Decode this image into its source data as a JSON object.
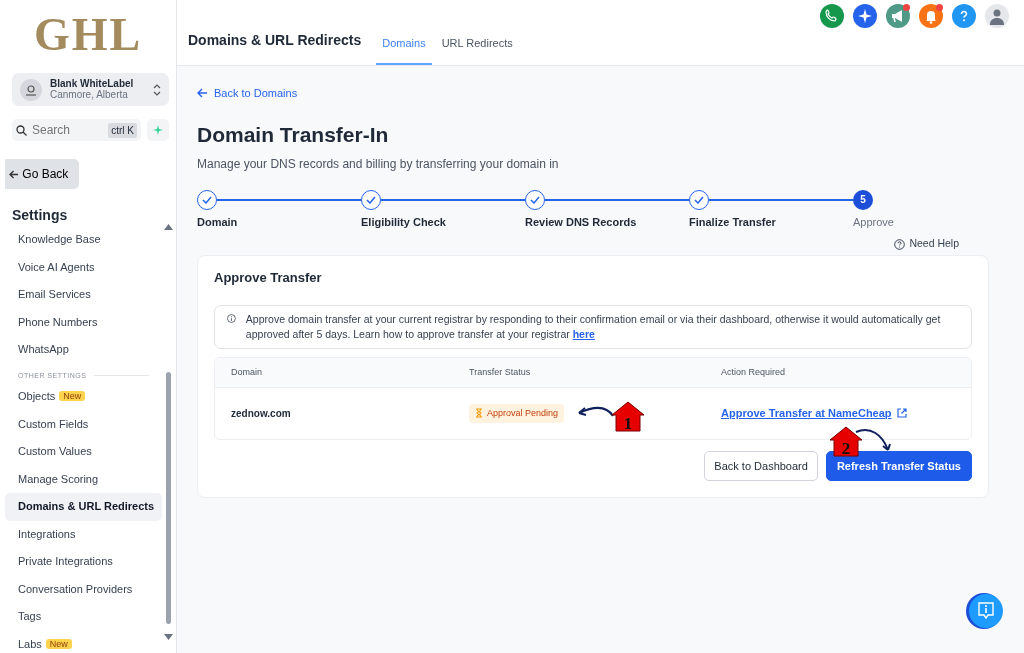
{
  "sidebar": {
    "logo": "GHL",
    "account": {
      "name": "Blank WhiteLabel",
      "location": "Canmore, Alberta"
    },
    "search": {
      "placeholder": "Search",
      "shortcut": "ctrl K"
    },
    "go_back": "Go Back",
    "heading": "Settings",
    "items": [
      {
        "kind": "item",
        "label": "Knowledge Base",
        "selected": false
      },
      {
        "kind": "item",
        "label": "Voice AI Agents",
        "selected": false
      },
      {
        "kind": "item",
        "label": "Email Services",
        "selected": false
      },
      {
        "kind": "item",
        "label": "Phone Numbers",
        "selected": false
      },
      {
        "kind": "item",
        "label": "WhatsApp",
        "selected": false
      },
      {
        "kind": "section",
        "label": "OTHER SETTINGS"
      },
      {
        "kind": "item",
        "label": "Objects",
        "badge": "New",
        "selected": false
      },
      {
        "kind": "item",
        "label": "Custom Fields",
        "selected": false
      },
      {
        "kind": "item",
        "label": "Custom Values",
        "selected": false
      },
      {
        "kind": "item",
        "label": "Manage Scoring",
        "selected": false
      },
      {
        "kind": "item",
        "label": "Domains & URL Redirects",
        "selected": true
      },
      {
        "kind": "item",
        "label": "Integrations",
        "selected": false
      },
      {
        "kind": "item",
        "label": "Private Integrations",
        "selected": false
      },
      {
        "kind": "item",
        "label": "Conversation Providers",
        "selected": false
      },
      {
        "kind": "item",
        "label": "Tags",
        "selected": false
      },
      {
        "kind": "item",
        "label": "Labs",
        "badge": "New",
        "selected": false
      }
    ]
  },
  "header": {
    "title": "Domains & URL Redirects",
    "tabs": [
      {
        "label": "Domains",
        "selected": true
      },
      {
        "label": "URL Redirects",
        "selected": false
      }
    ],
    "icons": [
      {
        "kind": "phone",
        "color": "#16984c",
        "dot": false
      },
      {
        "kind": "sparkle",
        "color": "#2563eb",
        "dot": false
      },
      {
        "kind": "megaphone",
        "color": "#4e9a86",
        "dot": true
      },
      {
        "kind": "bell",
        "color": "#f97316",
        "dot": true
      },
      {
        "kind": "help",
        "color": "#2196f3",
        "dot": false
      },
      {
        "kind": "avatar",
        "color": "#e5e7eb",
        "dot": false
      }
    ]
  },
  "back_link": "Back to Domains",
  "title": "Domain Transfer-In",
  "subtitle": "Manage your DNS records and billing by transferring your domain in",
  "steps": [
    {
      "label": "Domain",
      "done": true
    },
    {
      "label": "Eligibility Check",
      "done": true
    },
    {
      "label": "Review DNS Records",
      "done": true
    },
    {
      "label": "Finalize Transfer",
      "done": true
    },
    {
      "label": "Approve",
      "done": false,
      "number": "5"
    }
  ],
  "need_help": "Need Help",
  "card": {
    "title": "Approve Transfer",
    "info": "Approve domain transfer at your current registrar by responding to their confirmation email or via their dashboard, otherwise it would automatically get approved after 5 days. Learn how to approve transfer at your registrar",
    "info_link": "here",
    "table": {
      "columns": [
        "Domain",
        "Transfer Status",
        "Action Required"
      ],
      "rows": [
        {
          "domain": "zednow.com",
          "status": "Approval Pending",
          "action": "Approve Transfer at NameCheap"
        }
      ]
    },
    "buttons": [
      {
        "label": "Back to Dashboard",
        "kind": "secondary"
      },
      {
        "label": "Refresh Transfer Status",
        "kind": "primary"
      }
    ]
  },
  "annotations": [
    {
      "label": "1"
    },
    {
      "label": "2"
    }
  ]
}
